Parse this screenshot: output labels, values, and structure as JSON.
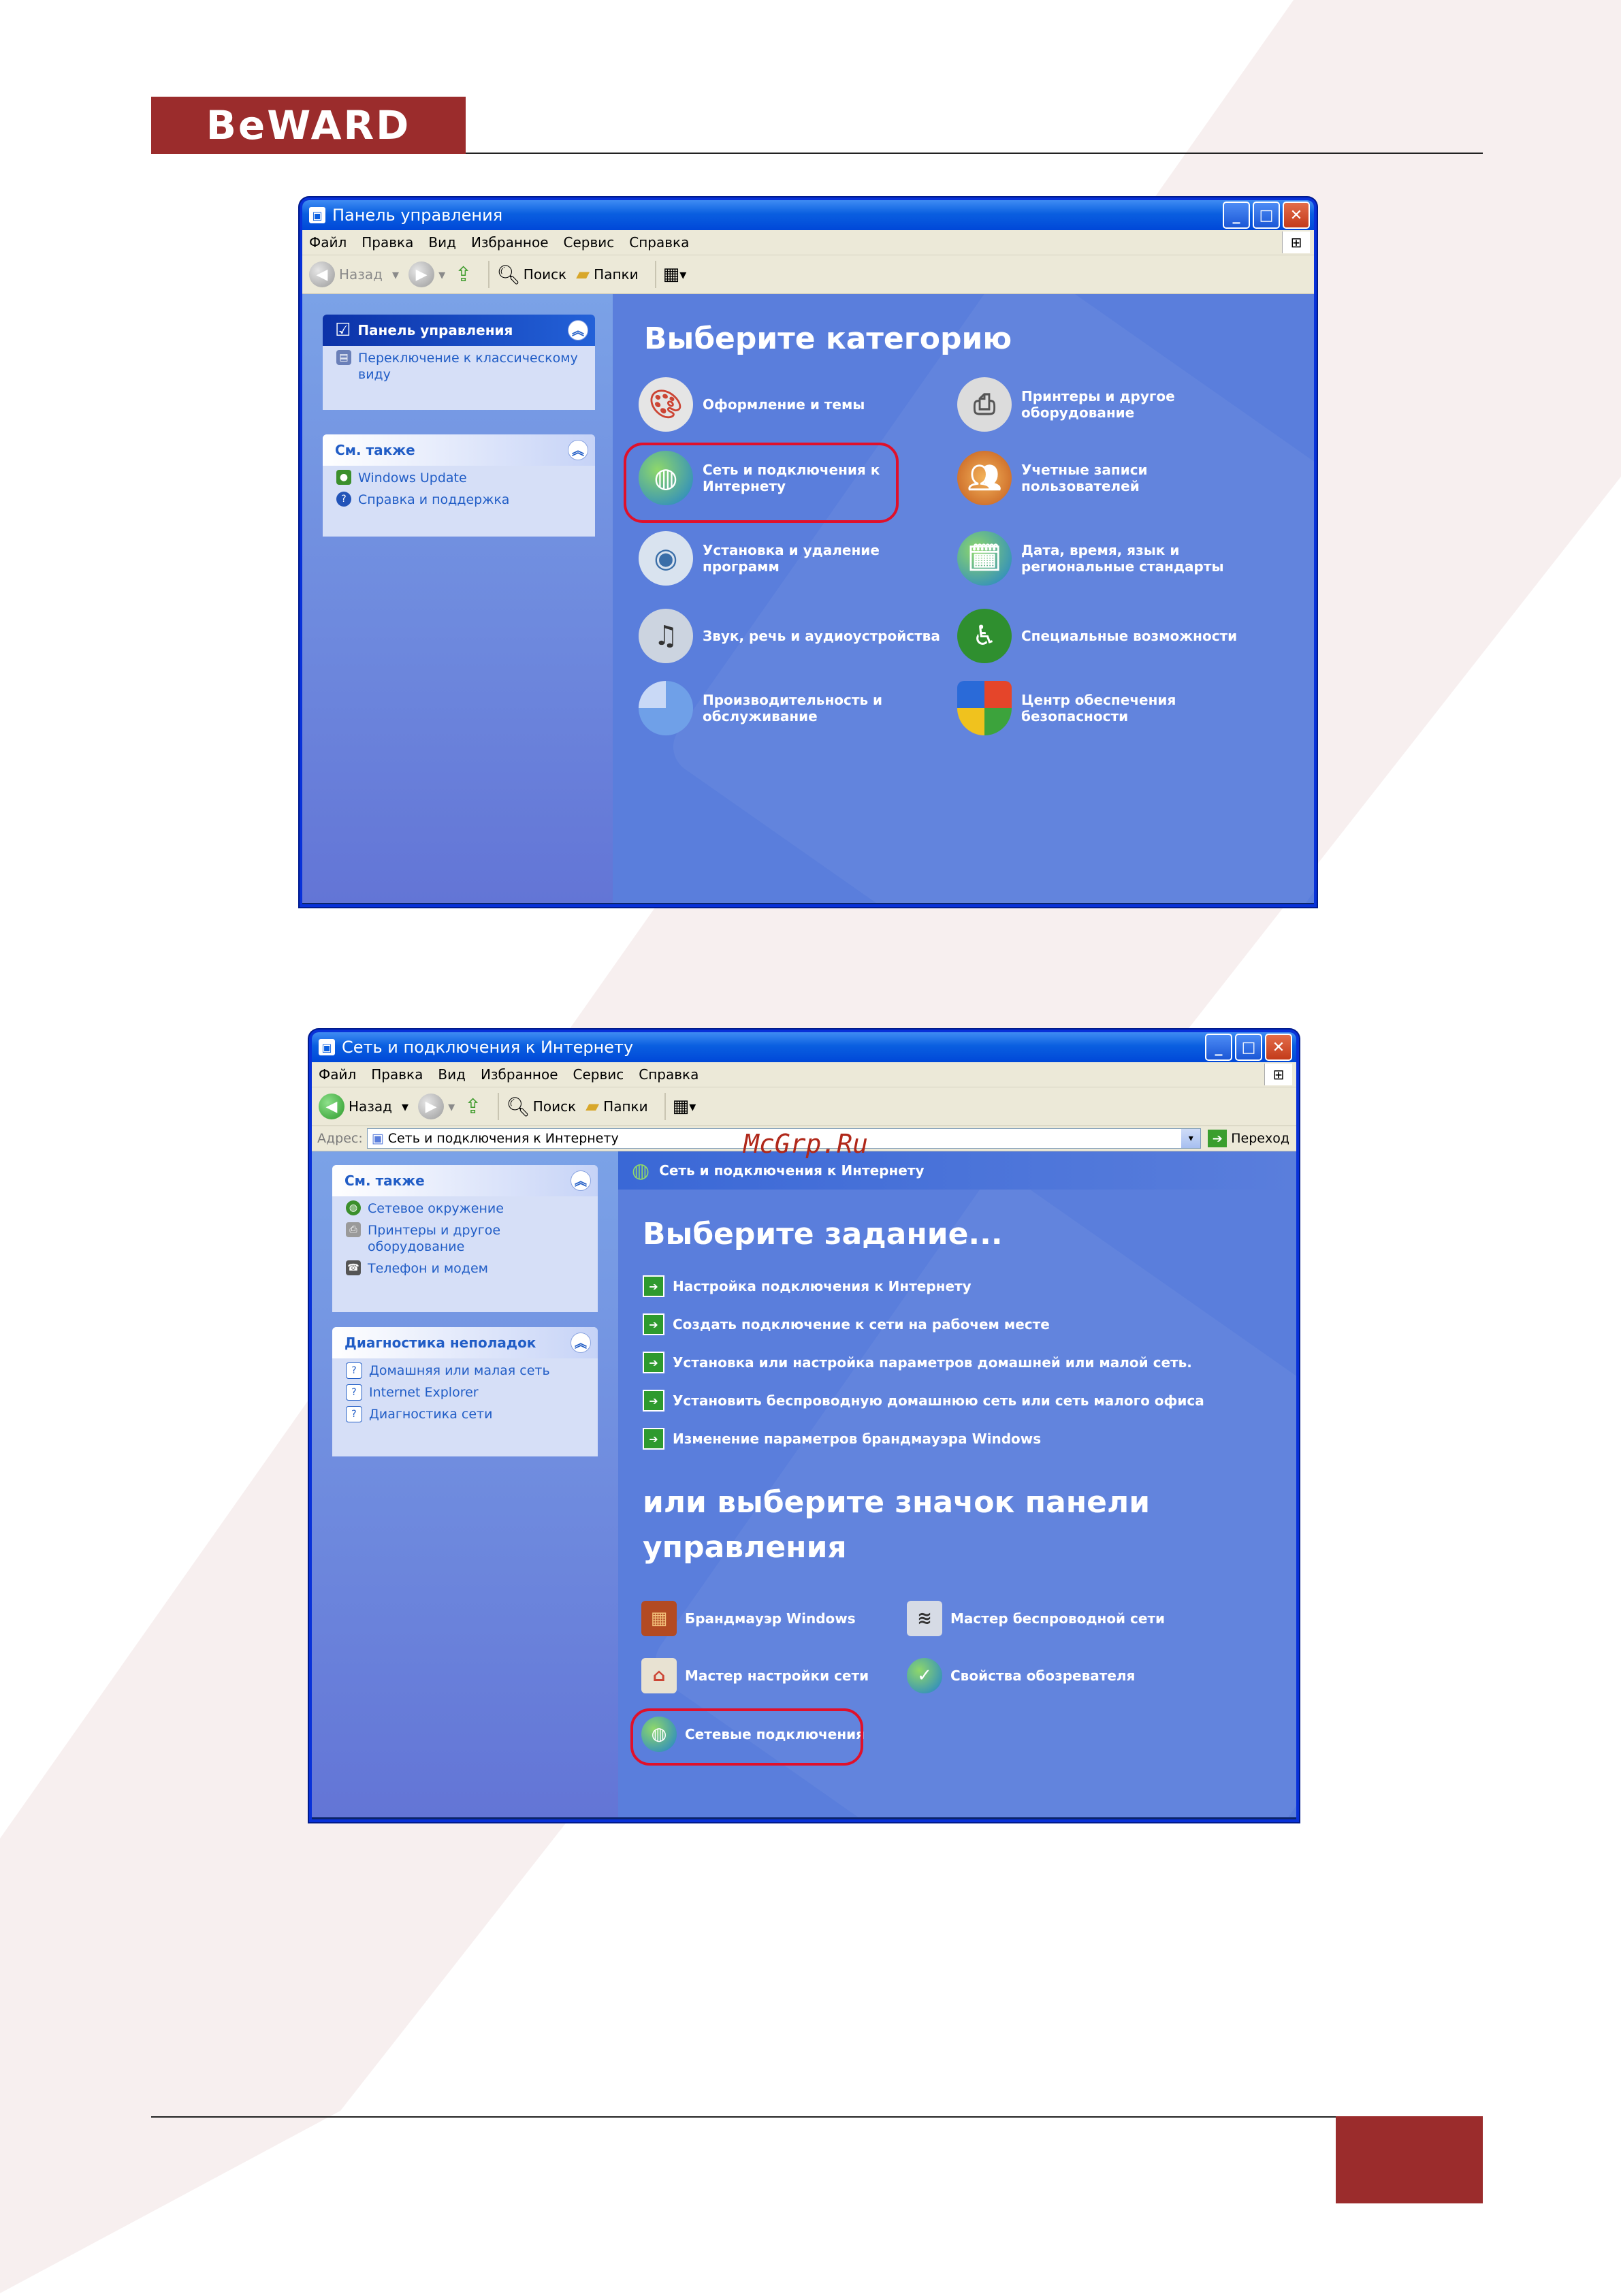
{
  "brand": {
    "logo": "BeWARD"
  },
  "window1": {
    "title": "Панель управления",
    "menu": [
      "Файл",
      "Правка",
      "Вид",
      "Избранное",
      "Сервис",
      "Справка"
    ],
    "toolbar": {
      "back": "Назад",
      "search": "Поиск",
      "folders": "Папки"
    },
    "left": {
      "pane1_title": "Панель управления",
      "pane1_item": "Переключение к классическому виду",
      "pane2_title": "См. также",
      "pane2_items": [
        "Windows Update",
        "Справка и поддержка"
      ]
    },
    "heading": "Выберите категорию",
    "categories": [
      "Оформление и темы",
      "Принтеры и другое оборудование",
      "Сеть и подключения к Интернету",
      "Учетные записи пользователей",
      "Установка и удаление программ",
      "Дата, время, язык и региональные стандарты",
      "Звук, речь и аудиоустройства",
      "Специальные возможности",
      "Производительность и обслуживание",
      "Центр обеспечения безопасности"
    ]
  },
  "window2": {
    "title": "Сеть и подключения к Интернету",
    "menu": [
      "Файл",
      "Правка",
      "Вид",
      "Избранное",
      "Сервис",
      "Справка"
    ],
    "toolbar": {
      "back": "Назад",
      "search": "Поиск",
      "folders": "Папки"
    },
    "address": {
      "label": "Адрес:",
      "value": "Сеть и подключения к Интернету",
      "go": "Переход"
    },
    "left": {
      "pane1_title": "См. также",
      "pane1_items": [
        "Сетевое окружение",
        "Принтеры и другое оборудование",
        "Телефон и модем"
      ],
      "pane2_title": "Диагностика неполадок",
      "pane2_items": [
        "Домашняя или малая сеть",
        "Internet Explorer",
        "Диагностика сети"
      ]
    },
    "banner": "Сеть и подключения к Интернету",
    "heading_tasks": "Выберите задание...",
    "tasks": [
      "Настройка подключения к Интернету",
      "Создать подключение к сети на рабочем месте",
      "Установка или настройка параметров домашней или малой сеть.",
      "Установить беспроводную домашнюю сеть или сеть малого офиса",
      "Изменение параметров брандмауэра Windows"
    ],
    "heading_icons_1": "или выберите значок панели",
    "heading_icons_2": "управления",
    "icons": [
      "Брандмауэр Windows",
      "Мастер беспроводной сети",
      "Мастер настройки сети",
      "Свойства обозревателя",
      "Сетевые подключения"
    ]
  },
  "watermark_text": "McGrp.Ru"
}
